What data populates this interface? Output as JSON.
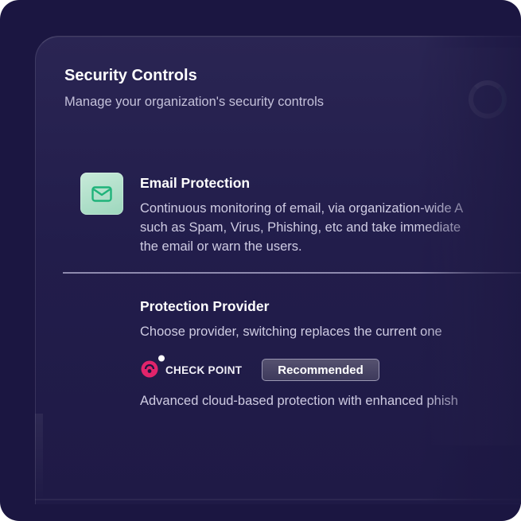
{
  "header": {
    "title": "Security Controls",
    "subtitle": "Manage your organization's security controls"
  },
  "email_protection": {
    "icon": "envelope-icon",
    "title": "Email Protection",
    "description_lines": [
      "Continuous monitoring of email, via organization-wide A",
      "such as Spam, Virus, Phishing, etc and take immediate",
      "the email or warn the users."
    ]
  },
  "protection_provider": {
    "title": "Protection Provider",
    "description": "Choose provider, switching replaces the current one",
    "provider": {
      "logo": "check-point-logo",
      "name": "CHECK POINT",
      "badge": "Recommended",
      "description": "Advanced cloud-based protection with enhanced phish"
    }
  },
  "colors": {
    "background": "#1b1641",
    "card": "#242050",
    "accent_green": "#1fb37a",
    "brand_pink": "#e1246b"
  }
}
